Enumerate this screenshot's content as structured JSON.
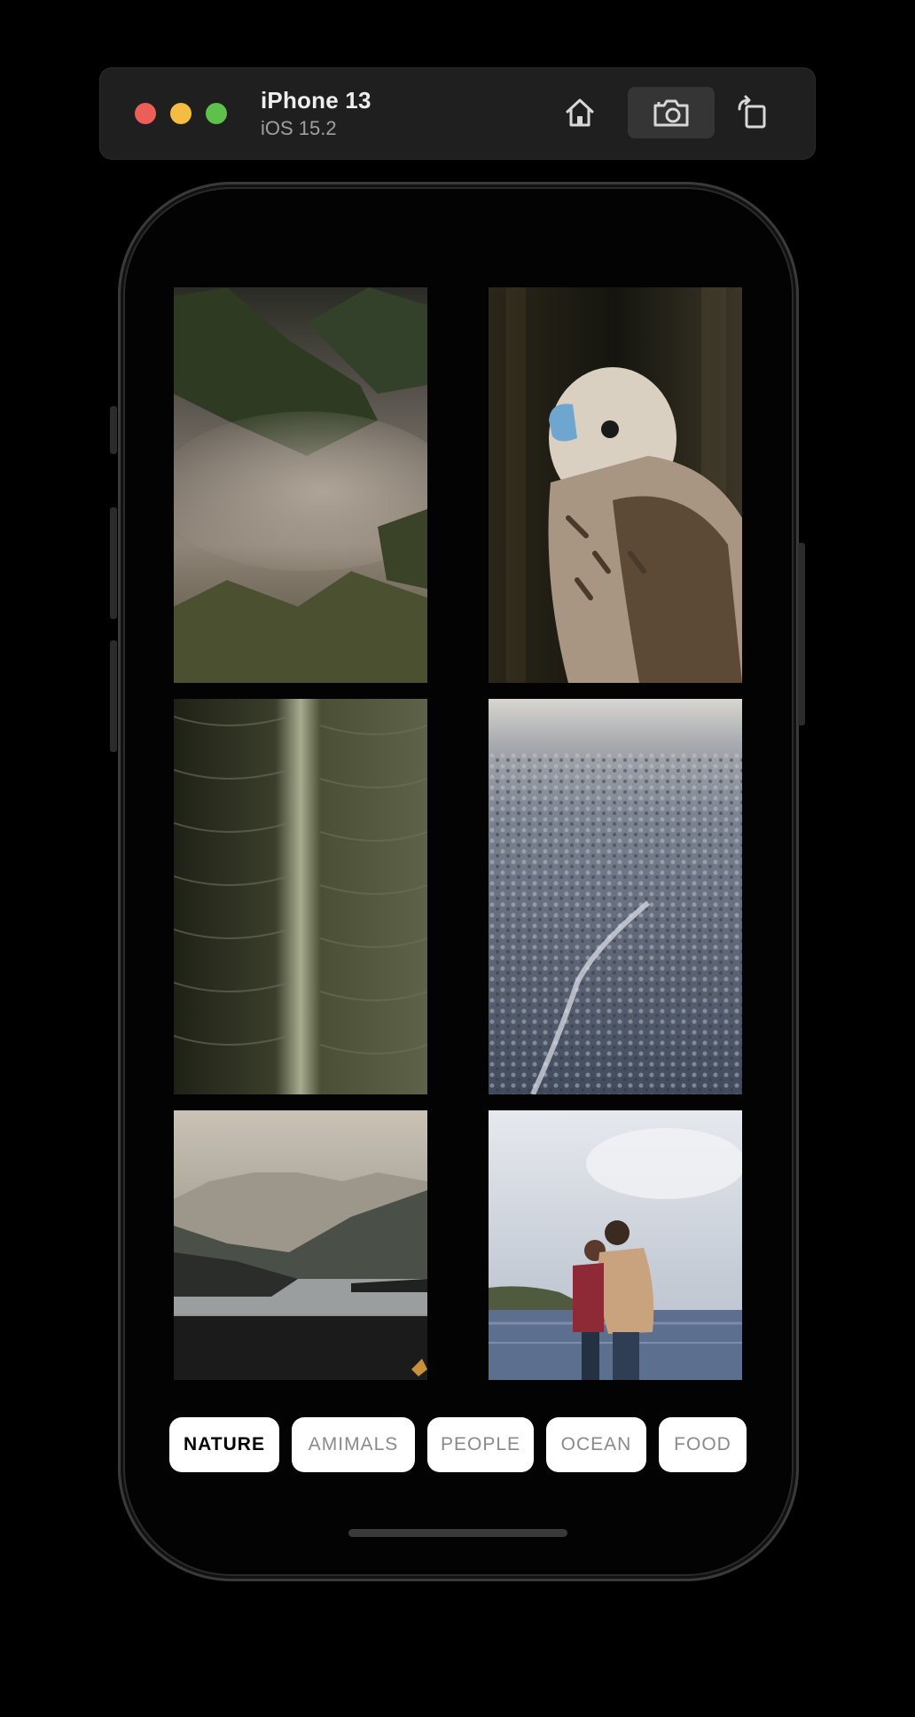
{
  "simulator": {
    "device_name": "iPhone 13",
    "os_version": "iOS 15.2",
    "buttons": {
      "home": "home-icon",
      "screenshot": "camera-icon",
      "rotate": "rotate-icon"
    }
  },
  "gallery": {
    "photos": [
      {
        "subject": "misty forested mountains"
      },
      {
        "subject": "falcon portrait"
      },
      {
        "subject": "green leaf close-up"
      },
      {
        "subject": "snowy forest aerial"
      },
      {
        "subject": "mountain lake"
      },
      {
        "subject": "couple embracing by the sea"
      }
    ]
  },
  "categories": {
    "selected": "NATURE",
    "items": [
      {
        "label": "NATURE"
      },
      {
        "label": "AMIMALS"
      },
      {
        "label": "PEOPLE"
      },
      {
        "label": "OCEAN"
      },
      {
        "label": "FOOD"
      }
    ]
  },
  "colors": {
    "background": "#000000",
    "chip_background": "#ffffff",
    "chip_active_text": "#000000",
    "chip_inactive_text": "#8a8a8a",
    "traffic_close": "#ec5f57",
    "traffic_minimize": "#f4bd41",
    "traffic_maximize": "#5dc14c"
  }
}
